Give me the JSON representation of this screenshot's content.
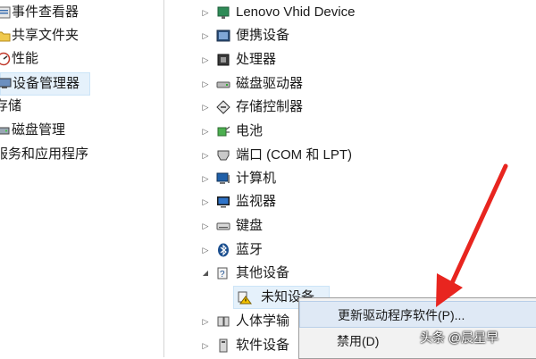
{
  "left_nav": {
    "items": [
      {
        "label": "事件查看器",
        "icon": "event-viewer-icon"
      },
      {
        "label": "共享文件夹",
        "icon": "shared-folder-icon"
      },
      {
        "label": "性能",
        "icon": "performance-icon"
      },
      {
        "label": "设备管理器",
        "icon": "device-manager-icon",
        "selected": true
      },
      {
        "label": "存储",
        "icon": ""
      },
      {
        "label": "磁盘管理",
        "icon": "disk-management-icon"
      },
      {
        "label": "服务和应用程序",
        "icon": ""
      }
    ]
  },
  "device_tree": {
    "items": [
      {
        "label": "Lenovo Vhid Device",
        "icon": "hid-device-icon",
        "expanded": false
      },
      {
        "label": "便携设备",
        "icon": "portable-device-icon",
        "expanded": false
      },
      {
        "label": "处理器",
        "icon": "processor-icon",
        "expanded": false
      },
      {
        "label": "磁盘驱动器",
        "icon": "disk-drive-icon",
        "expanded": false
      },
      {
        "label": "存储控制器",
        "icon": "storage-controller-icon",
        "expanded": false
      },
      {
        "label": "电池",
        "icon": "battery-icon",
        "expanded": false
      },
      {
        "label": "端口 (COM 和 LPT)",
        "icon": "port-icon",
        "expanded": false
      },
      {
        "label": "计算机",
        "icon": "computer-icon",
        "expanded": false
      },
      {
        "label": "监视器",
        "icon": "monitor-icon",
        "expanded": false
      },
      {
        "label": "键盘",
        "icon": "keyboard-icon",
        "expanded": false
      },
      {
        "label": "蓝牙",
        "icon": "bluetooth-icon",
        "expanded": false
      },
      {
        "label": "其他设备",
        "icon": "other-devices-icon",
        "expanded": true
      },
      {
        "label": "未知设备",
        "icon": "unknown-device-warning-icon",
        "child": true
      },
      {
        "label": "人体学输",
        "icon": "hid-icon",
        "expanded": false
      },
      {
        "label": "软件设备",
        "icon": "software-device-icon",
        "expanded": false
      }
    ]
  },
  "context_menu": {
    "items": [
      {
        "label": "更新驱动程序软件(P)...",
        "highlighted": true
      },
      {
        "label": "禁用(D)"
      }
    ]
  },
  "watermark": "头条 @晨星早",
  "colors": {
    "annotation_arrow": "#e8251f",
    "selection": "#e5f1fb",
    "menu_bg": "#f2f2f2",
    "menu_highlight": "#dfe9f5"
  }
}
